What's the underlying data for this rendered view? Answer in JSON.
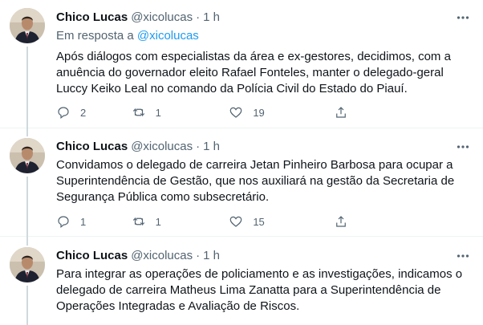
{
  "tweets": [
    {
      "name": "Chico Lucas",
      "handle": "@xicolucas",
      "time": "1 h",
      "reply_prefix": "Em resposta a ",
      "reply_handle": "@xicolucas",
      "text": "Após diálogos com especialistas da área e ex-gestores, decidimos, com a anuência do governador eleito Rafael Fonteles, manter o delegado-geral Luccy Keiko Leal no comando da Polícia Civil do Estado do Piauí.",
      "replies": "2",
      "retweets": "1",
      "likes": "19"
    },
    {
      "name": "Chico Lucas",
      "handle": "@xicolucas",
      "time": "1 h",
      "text": "Convidamos o delegado de carreira Jetan Pinheiro Barbosa para ocupar a Superintendência de Gestão, que nos auxiliará na gestão da Secretaria de Segurança Pública como subsecretário.",
      "replies": "1",
      "retweets": "1",
      "likes": "15"
    },
    {
      "name": "Chico Lucas",
      "handle": "@xicolucas",
      "time": "1 h",
      "text": "Para integrar as operações de policiamento e as investigações, indicamos o delegado de carreira Matheus Lima Zanatta para a Superintendência de Operações Integradas e Avaliação de Riscos."
    }
  ],
  "separator": "·",
  "icons": {
    "more": "more-dots-icon",
    "reply": "reply-bubble-icon",
    "retweet": "retweet-icon",
    "like": "heart-icon",
    "share": "share-upload-icon"
  },
  "colors": {
    "link": "#1d9bf0",
    "secondary_text": "#536471",
    "primary_text": "#0f1419",
    "divider": "#eff3f4"
  }
}
